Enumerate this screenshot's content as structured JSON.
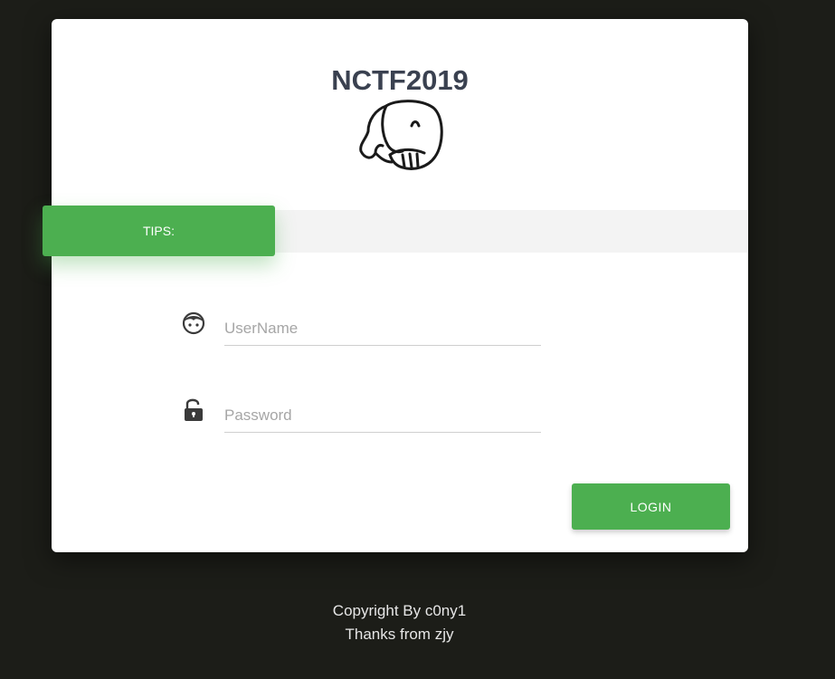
{
  "card": {
    "title": "NCTF2019",
    "logo_icon": "elephant-icon"
  },
  "tips": {
    "label": "TIPS:"
  },
  "form": {
    "username_icon": "user-face-icon",
    "username_placeholder": "UserName",
    "username_value": "",
    "password_icon": "unlock-icon",
    "password_placeholder": "Password",
    "password_value": "",
    "login_label": "LOGIN"
  },
  "footer": {
    "line1": "Copyright By c0ny1",
    "line2": "Thanks from zjy"
  },
  "colors": {
    "accent": "#4caf50",
    "background": "#1c1d18",
    "title": "#3a4150"
  }
}
